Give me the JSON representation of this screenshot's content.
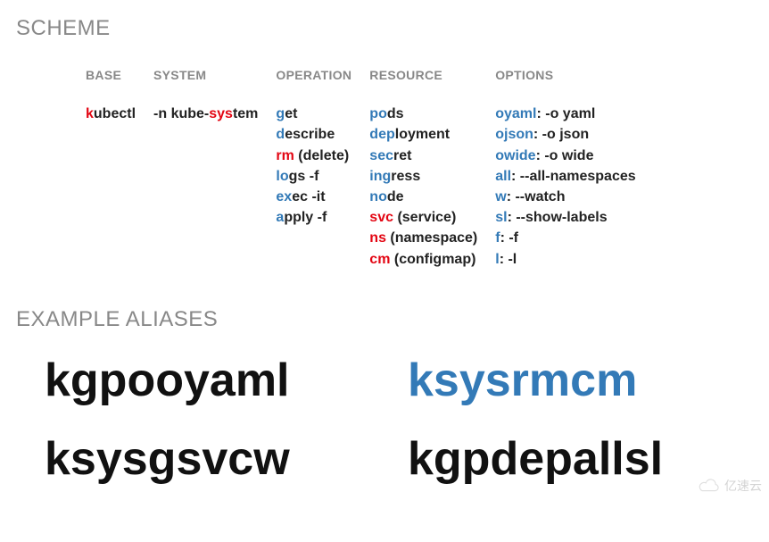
{
  "scheme_heading": "SCHEME",
  "examples_heading": "EXAMPLE ALIASES",
  "columns": {
    "base": {
      "head": "BASE"
    },
    "system": {
      "head": "SYSTEM"
    },
    "operation": {
      "head": "OPERATION"
    },
    "resource": {
      "head": "RESOURCE"
    },
    "options": {
      "head": "OPTIONS"
    }
  },
  "base": {
    "kubectl": {
      "hl": "k",
      "rest": "ubectl"
    }
  },
  "system": {
    "prefix": "-n kube-",
    "hl": "sys",
    "suffix": "tem"
  },
  "operation": [
    {
      "hl": "g",
      "rest": "et"
    },
    {
      "hl": "d",
      "rest": "escribe"
    },
    {
      "hl": "rm",
      "rest": " (delete)",
      "hlcolor": "red"
    },
    {
      "hl": "lo",
      "rest": "gs -f"
    },
    {
      "hl": "ex",
      "rest": "ec -it"
    },
    {
      "hl": "a",
      "rest": "pply -f"
    }
  ],
  "resource": [
    {
      "hl": "po",
      "rest": "ds"
    },
    {
      "hl": "dep",
      "rest": "loyment"
    },
    {
      "hl": "sec",
      "rest": "ret"
    },
    {
      "hl": "ing",
      "rest": "ress"
    },
    {
      "hl": "no",
      "rest": "de"
    },
    {
      "hl": "svc",
      "rest": " (service)",
      "hlcolor": "red"
    },
    {
      "hl": "ns",
      "rest": " (namespace)",
      "hlcolor": "red"
    },
    {
      "hl": "cm",
      "rest": " (configmap)",
      "hlcolor": "red"
    }
  ],
  "options": [
    {
      "hl": "oyaml",
      "rest": ": -o yaml"
    },
    {
      "hl": "ojson",
      "rest": ": -o json"
    },
    {
      "hl": "owide",
      "rest": ": -o wide"
    },
    {
      "hl": "all",
      "rest": ": --all-namespaces"
    },
    {
      "hl": "w",
      "rest": ": --watch"
    },
    {
      "hl": "sl",
      "rest": ": --show-labels"
    },
    {
      "hl": "f",
      "rest": ": -f"
    },
    {
      "hl": "l",
      "rest": ": -l"
    }
  ],
  "aliases": [
    {
      "text": "kgpooyaml",
      "color": "blk"
    },
    {
      "text": "ksysrmcm",
      "color": "blue"
    },
    {
      "text": "ksysgsvcw",
      "color": "blk"
    },
    {
      "text": "kgpdepallsl",
      "color": "blk"
    }
  ],
  "watermark": "亿速云"
}
